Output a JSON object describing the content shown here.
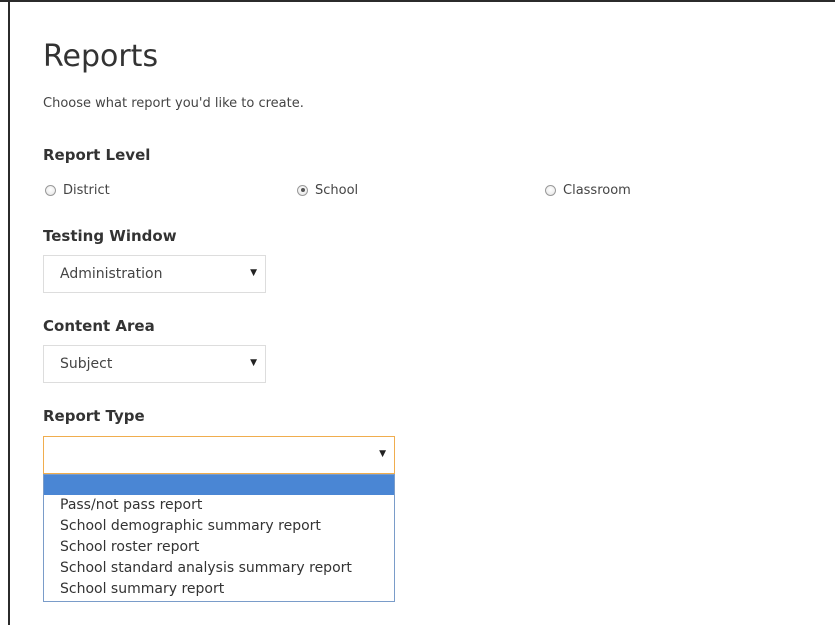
{
  "page": {
    "title": "Reports",
    "intro": "Choose what report you'd like to create."
  },
  "report_level": {
    "label": "Report Level",
    "options": [
      {
        "label": "District",
        "checked": false
      },
      {
        "label": "School",
        "checked": true
      },
      {
        "label": "Classroom",
        "checked": false
      }
    ]
  },
  "testing_window": {
    "label": "Testing Window",
    "selected": "Administration"
  },
  "content_area": {
    "label": "Content Area",
    "selected": "Subject"
  },
  "report_type": {
    "label": "Report Type",
    "selected": "",
    "options": [
      "",
      "Pass/not pass report",
      "School demographic summary report",
      "School roster report",
      "School standard analysis summary report",
      "School summary report"
    ]
  },
  "icons": {
    "select_arrow": "triangle-down-icon",
    "dropdown_arrow_glyph": "▼"
  },
  "colors": {
    "focus_border": "#f0ad4e",
    "highlight": "#4a86d4"
  }
}
